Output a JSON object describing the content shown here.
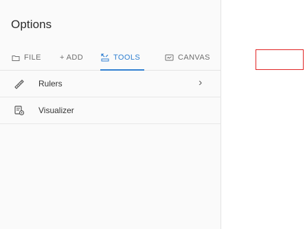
{
  "panel": {
    "title": "Options",
    "tabs": [
      {
        "label": "FILE",
        "icon": "folder-icon"
      },
      {
        "label": "+ ADD",
        "icon": "plus-icon"
      },
      {
        "label": "TOOLS",
        "icon": "tools-icon",
        "active": true
      },
      {
        "label": "CANVAS",
        "icon": "canvas-icon"
      }
    ],
    "items": [
      {
        "label": "Rulers",
        "icon": "ruler-icon",
        "has_chevron": true
      },
      {
        "label": "Visualizer",
        "icon": "visualizer-icon",
        "has_chevron": false
      }
    ]
  },
  "colors": {
    "accent": "#2f7fd1",
    "highlight_box": "#e02020"
  }
}
